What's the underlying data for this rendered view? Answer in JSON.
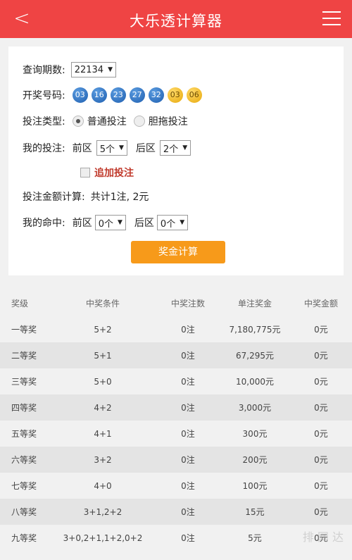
{
  "header": {
    "title": "大乐透计算器",
    "back_label": "<"
  },
  "form": {
    "issue_label": "查询期数:",
    "issue_value": "22134",
    "draw_label": "开奖号码:",
    "draw_numbers": {
      "front": [
        "03",
        "16",
        "23",
        "27",
        "32"
      ],
      "back": [
        "03",
        "06"
      ]
    },
    "bet_type_label": "投注类型:",
    "bet_type_options": [
      "普通投注",
      "胆拖投注"
    ],
    "my_bet_label": "我的投注:",
    "front_label": "前区",
    "front_value": "5个",
    "back_label": "后区",
    "back_value": "2个",
    "extra_label": "追加投注",
    "amount_label": "投注金额计算:",
    "amount_value": "共计1注, 2元",
    "hit_label": "我的命中:",
    "hit_front_value": "0个",
    "hit_back_value": "0个",
    "calc_button": "奖金计算"
  },
  "table": {
    "headers": [
      "奖级",
      "中奖条件",
      "中奖注数",
      "单注奖金",
      "中奖金额"
    ],
    "rows": [
      [
        "一等奖",
        "5+2",
        "0注",
        "7,180,775元",
        "0元"
      ],
      [
        "二等奖",
        "5+1",
        "0注",
        "67,295元",
        "0元"
      ],
      [
        "三等奖",
        "5+0",
        "0注",
        "10,000元",
        "0元"
      ],
      [
        "四等奖",
        "4+2",
        "0注",
        "3,000元",
        "0元"
      ],
      [
        "五等奖",
        "4+1",
        "0注",
        "300元",
        "0元"
      ],
      [
        "六等奖",
        "3+2",
        "0注",
        "200元",
        "0元"
      ],
      [
        "七等奖",
        "4+0",
        "0注",
        "100元",
        "0元"
      ],
      [
        "八等奖",
        "3+1,2+2",
        "0注",
        "15元",
        "0元"
      ],
      [
        "九等奖",
        "3+0,2+1,1+2,0+2",
        "0注",
        "5元",
        "0元"
      ]
    ]
  },
  "watermark": "排 网 达",
  "colors": {
    "header": "#ef4444",
    "button": "#f79a1a",
    "front_ball": "#2a6cc0",
    "back_ball": "#f0b417"
  }
}
